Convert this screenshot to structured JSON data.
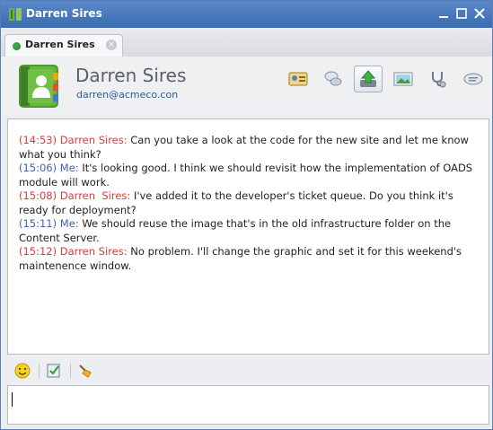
{
  "window": {
    "title": "Darren Sires",
    "controls": [
      "minimize-icon",
      "maximize-icon",
      "close-icon"
    ]
  },
  "tab": {
    "label": "Darren Sires",
    "status_color": "#3aa842"
  },
  "contact": {
    "name": "Darren Sires",
    "email": "darren@acmeco.con"
  },
  "header_tools": [
    {
      "icon": "contact-card-icon",
      "active": false
    },
    {
      "icon": "chat-bubbles-icon",
      "active": false
    },
    {
      "icon": "send-file-icon",
      "active": true
    },
    {
      "icon": "image-icon",
      "active": false
    },
    {
      "icon": "stethoscope-icon",
      "active": false
    },
    {
      "icon": "comment-icon",
      "active": false
    }
  ],
  "messages": [
    {
      "time": "(14:53)",
      "sender": "Darren Sires:",
      "is_me": false,
      "text": "Can you take a look at the code for the new site and let me know what you think?"
    },
    {
      "time": "(15:06)",
      "sender": "Me:",
      "is_me": true,
      "text": "It's looking good. I think we should revisit how the implementation of OADS module will work."
    },
    {
      "time": "(15:08)",
      "sender": "Darren  Sires:",
      "is_me": false,
      "text": "I've added it to the developer's ticket queue. Do you think it's ready for deployment?"
    },
    {
      "time": "(15:11)",
      "sender": "Me:",
      "is_me": true,
      "text": "We should reuse the image that's in the old infrastructure folder on the Content Server."
    },
    {
      "time": "(15:12)",
      "sender": "Darren Sires:",
      "is_me": false,
      "text": "No problem. I'll change the graphic and set it for this weekend's maintenence window."
    }
  ],
  "compose": {
    "value": "",
    "tools": [
      "smiley-icon",
      "spellcheck-icon",
      "broom-icon"
    ]
  },
  "colors": {
    "other_sender": "#d23d3d",
    "me_sender": "#3d62b4",
    "titlebar": "#4a7bc0"
  }
}
